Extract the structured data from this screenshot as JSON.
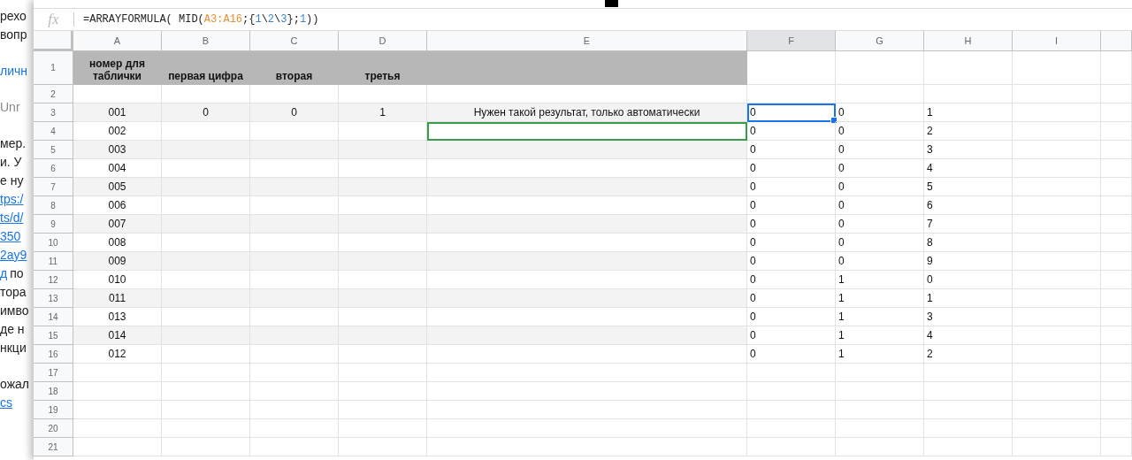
{
  "background_page": {
    "lines": [
      {
        "parts": [
          {
            "text": "рехо",
            "kind": "text"
          }
        ]
      },
      {
        "parts": [
          {
            "text": "вопр",
            "kind": "text"
          }
        ]
      },
      {
        "kind": "gap"
      },
      {
        "parts": [
          {
            "text": "личн",
            "kind": "accent"
          }
        ]
      },
      {
        "kind": "gap"
      },
      {
        "parts": [
          {
            "text": "Unr",
            "kind": "muted"
          }
        ]
      },
      {
        "kind": "gap"
      },
      {
        "parts": [
          {
            "text": "мер.",
            "kind": "text"
          }
        ]
      },
      {
        "parts": [
          {
            "text": "и. У",
            "kind": "text"
          }
        ]
      },
      {
        "parts": [
          {
            "text": "е ну",
            "kind": "text"
          }
        ]
      },
      {
        "parts": [
          {
            "text": "tps:/",
            "kind": "link"
          }
        ]
      },
      {
        "parts": [
          {
            "text": "ts/d/",
            "kind": "link"
          }
        ]
      },
      {
        "parts": [
          {
            "text": "350",
            "kind": "link"
          }
        ]
      },
      {
        "parts": [
          {
            "text": "2ay9",
            "kind": "link"
          }
        ]
      },
      {
        "parts": [
          {
            "text": "д",
            "kind": "link"
          },
          {
            "text": "по",
            "kind": "text"
          }
        ]
      },
      {
        "parts": [
          {
            "text": "тора",
            "kind": "text"
          }
        ]
      },
      {
        "parts": [
          {
            "text": "имво",
            "kind": "text"
          }
        ]
      },
      {
        "parts": [
          {
            "text": "де н",
            "kind": "text"
          }
        ]
      },
      {
        "parts": [
          {
            "text": "нкци",
            "kind": "text"
          }
        ]
      },
      {
        "kind": "gap"
      },
      {
        "parts": [
          {
            "text": "ожал",
            "kind": "text"
          }
        ]
      },
      {
        "parts": [
          {
            "text": "cs",
            "kind": "link"
          }
        ]
      }
    ]
  },
  "formula_bar": {
    "icon": "fx",
    "tokens": [
      {
        "text": "=ARRAYFORMULA( MID(",
        "kind": "plain"
      },
      {
        "text": "A3:A16",
        "kind": "range"
      },
      {
        "text": ";{",
        "kind": "plain"
      },
      {
        "text": "1",
        "kind": "number"
      },
      {
        "text": "\\",
        "kind": "plain"
      },
      {
        "text": "2",
        "kind": "number"
      },
      {
        "text": "\\",
        "kind": "plain"
      },
      {
        "text": "3",
        "kind": "number"
      },
      {
        "text": "};",
        "kind": "plain"
      },
      {
        "text": "1",
        "kind": "number"
      },
      {
        "text": "))",
        "kind": "plain"
      }
    ]
  },
  "columns": [
    {
      "label": "A",
      "selected": false,
      "banded": true,
      "collaborator": false
    },
    {
      "label": "B",
      "selected": false,
      "banded": true,
      "collaborator": false
    },
    {
      "label": "C",
      "selected": false,
      "banded": true,
      "collaborator": false
    },
    {
      "label": "D",
      "selected": false,
      "banded": true,
      "collaborator": false
    },
    {
      "label": "E",
      "selected": false,
      "banded": true,
      "collaborator": true
    },
    {
      "label": "F",
      "selected": true,
      "banded": false,
      "collaborator": false
    },
    {
      "label": "G",
      "selected": false,
      "banded": false,
      "collaborator": false
    },
    {
      "label": "H",
      "selected": false,
      "banded": false,
      "collaborator": false
    },
    {
      "label": "I",
      "selected": false,
      "banded": false,
      "collaborator": false
    }
  ],
  "rows": [
    {
      "number": "1",
      "header": true,
      "banded": false,
      "selected": false,
      "collaborator": false,
      "cells": [
        "номер для таблички",
        "первая цифра",
        "вторая",
        "третья"
      ]
    },
    {
      "number": "2",
      "header": false,
      "banded": false,
      "selected": false,
      "collaborator": false,
      "cells": []
    },
    {
      "number": "3",
      "header": false,
      "banded": true,
      "selected": true,
      "collaborator": false,
      "cells": [
        "001",
        "0",
        "0",
        "1",
        "Нужен такой результат, только автоматически",
        "0",
        "0",
        "1"
      ]
    },
    {
      "number": "4",
      "header": false,
      "banded": false,
      "selected": false,
      "collaborator": true,
      "cells": [
        "002",
        null,
        null,
        null,
        null,
        "0",
        "0",
        "2"
      ]
    },
    {
      "number": "5",
      "header": false,
      "banded": true,
      "selected": false,
      "collaborator": false,
      "cells": [
        "003",
        null,
        null,
        null,
        null,
        "0",
        "0",
        "3"
      ]
    },
    {
      "number": "6",
      "header": false,
      "banded": false,
      "selected": false,
      "collaborator": false,
      "cells": [
        "004",
        null,
        null,
        null,
        null,
        "0",
        "0",
        "4"
      ]
    },
    {
      "number": "7",
      "header": false,
      "banded": true,
      "selected": false,
      "collaborator": false,
      "cells": [
        "005",
        null,
        null,
        null,
        null,
        "0",
        "0",
        "5"
      ]
    },
    {
      "number": "8",
      "header": false,
      "banded": false,
      "selected": false,
      "collaborator": false,
      "cells": [
        "006",
        null,
        null,
        null,
        null,
        "0",
        "0",
        "6"
      ]
    },
    {
      "number": "9",
      "header": false,
      "banded": true,
      "selected": false,
      "collaborator": false,
      "cells": [
        "007",
        null,
        null,
        null,
        null,
        "0",
        "0",
        "7"
      ]
    },
    {
      "number": "10",
      "header": false,
      "banded": false,
      "selected": false,
      "collaborator": false,
      "cells": [
        "008",
        null,
        null,
        null,
        null,
        "0",
        "0",
        "8"
      ]
    },
    {
      "number": "11",
      "header": false,
      "banded": true,
      "selected": false,
      "collaborator": false,
      "cells": [
        "009",
        null,
        null,
        null,
        null,
        "0",
        "0",
        "9"
      ]
    },
    {
      "number": "12",
      "header": false,
      "banded": false,
      "selected": false,
      "collaborator": false,
      "cells": [
        "010",
        null,
        null,
        null,
        null,
        "0",
        "1",
        "0"
      ]
    },
    {
      "number": "13",
      "header": false,
      "banded": true,
      "selected": false,
      "collaborator": false,
      "cells": [
        "011",
        null,
        null,
        null,
        null,
        "0",
        "1",
        "1"
      ]
    },
    {
      "number": "14",
      "header": false,
      "banded": false,
      "selected": false,
      "collaborator": false,
      "cells": [
        "013",
        null,
        null,
        null,
        null,
        "0",
        "1",
        "3"
      ]
    },
    {
      "number": "15",
      "header": false,
      "banded": true,
      "selected": false,
      "collaborator": false,
      "cells": [
        "014",
        null,
        null,
        null,
        null,
        "0",
        "1",
        "4"
      ]
    },
    {
      "number": "16",
      "header": false,
      "banded": false,
      "selected": false,
      "collaborator": false,
      "cells": [
        "012",
        null,
        null,
        null,
        null,
        "0",
        "1",
        "2"
      ]
    },
    {
      "number": "17",
      "header": false,
      "banded": false,
      "selected": false,
      "collaborator": false,
      "cells": []
    },
    {
      "number": "18",
      "header": false,
      "banded": false,
      "selected": false,
      "collaborator": false,
      "cells": []
    },
    {
      "number": "19",
      "header": false,
      "banded": false,
      "selected": false,
      "collaborator": false,
      "cells": []
    },
    {
      "number": "20",
      "header": false,
      "banded": false,
      "selected": false,
      "collaborator": false,
      "cells": []
    },
    {
      "number": "21",
      "header": false,
      "banded": false,
      "selected": false,
      "collaborator": false,
      "cells": []
    }
  ]
}
